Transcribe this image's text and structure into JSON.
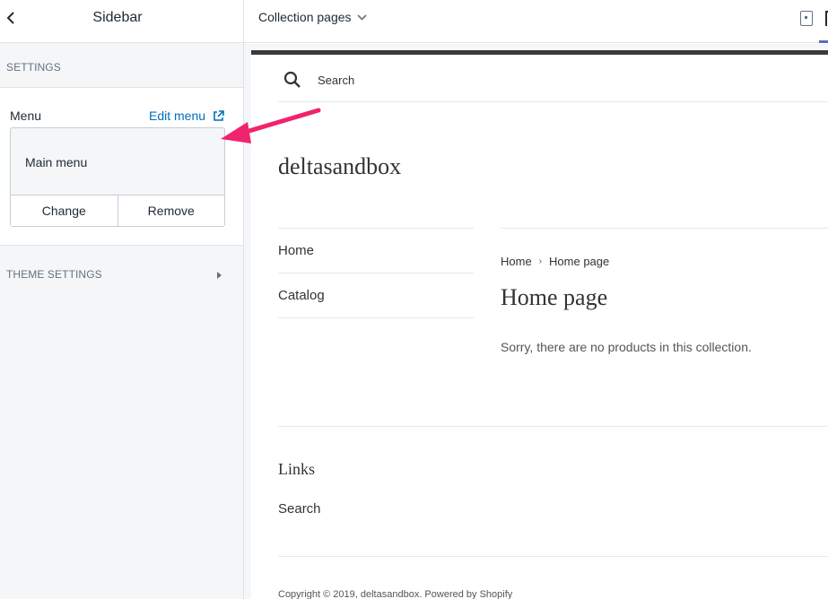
{
  "editor": {
    "title": "Sidebar",
    "settings_label": "SETTINGS",
    "menu_label": "Menu",
    "edit_menu_label": "Edit menu",
    "selected_menu": "Main menu",
    "change_label": "Change",
    "remove_label": "Remove",
    "theme_settings_label": "THEME SETTINGS"
  },
  "topbar": {
    "page_selector": "Collection pages"
  },
  "store": {
    "search_placeholder": "Search",
    "name": "deltasandbox",
    "nav": [
      "Home",
      "Catalog"
    ],
    "breadcrumb": [
      "Home",
      "Home page"
    ],
    "page_title": "Home page",
    "empty_message": "Sorry, there are no products in this collection.",
    "footer_heading": "Links",
    "footer_links": [
      "Search"
    ],
    "copyright": "Copyright © 2019, deltasandbox. Powered by Shopify"
  },
  "colors": {
    "link": "#006fbb",
    "annotation_arrow": "#f0246e",
    "accent": "#5c6ac4"
  }
}
